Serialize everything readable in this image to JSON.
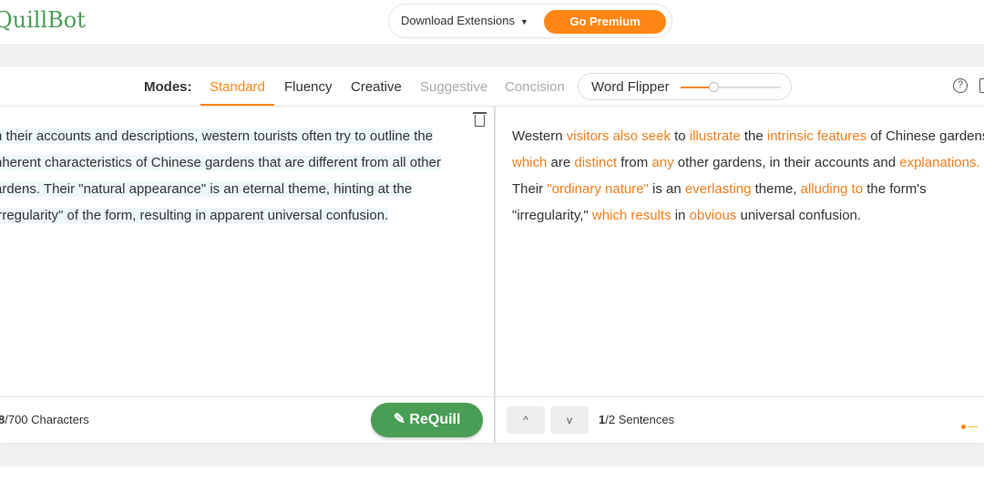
{
  "header": {
    "logo": "QuillBot",
    "download_label": "Download Extensions",
    "premium_label": "Go Premium",
    "accent": "#ff8615",
    "brand": "#4a9d54"
  },
  "modes": {
    "label": "Modes:",
    "items": [
      {
        "label": "Standard",
        "state": "active"
      },
      {
        "label": "Fluency",
        "state": "normal"
      },
      {
        "label": "Creative",
        "state": "normal"
      },
      {
        "label": "Suggestive",
        "state": "disabled"
      },
      {
        "label": "Concision",
        "state": "disabled"
      }
    ],
    "word_flipper": {
      "label": "Word Flipper",
      "level_percent": 33
    }
  },
  "input": {
    "lines": [
      "n their accounts and descriptions, western tourists often try to outline the",
      "nherent characteristics of Chinese gardens that are different from all other",
      "ardens. Their \"natural appearance\" is an eternal theme, hinting at the",
      "irregularity\" of the form, resulting in apparent universal confusion."
    ],
    "count_bold": "8",
    "count_rest": "/700 Characters",
    "requill_label": "ReQuill"
  },
  "output": {
    "lines": [
      [
        [
          "Western ",
          false
        ],
        [
          "visitors also seek",
          true
        ],
        [
          " to ",
          false
        ],
        [
          "illustrate",
          true
        ],
        [
          " the ",
          false
        ],
        [
          "intrinsic features",
          true
        ],
        [
          " of Chinese gardens",
          false
        ]
      ],
      [
        [
          "which",
          true
        ],
        [
          " are ",
          false
        ],
        [
          "distinct",
          true
        ],
        [
          " from ",
          false
        ],
        [
          "any",
          true
        ],
        [
          " other gardens, in their accounts and ",
          false
        ],
        [
          "explanations.",
          true
        ]
      ],
      [
        [
          "Their ",
          false
        ],
        [
          "\"ordinary nature\"",
          true
        ],
        [
          " is an ",
          false
        ],
        [
          "everlasting",
          true
        ],
        [
          " theme, ",
          false
        ],
        [
          "alluding to",
          true
        ],
        [
          " the form's",
          false
        ]
      ],
      [
        [
          "\"irregularity,\" ",
          false
        ],
        [
          "which results",
          true
        ],
        [
          " in ",
          false
        ],
        [
          "obvious",
          true
        ],
        [
          " universal confusion.",
          false
        ]
      ]
    ],
    "sentence_bold": "1",
    "sentence_rest": "/2 Sentences",
    "up": "^",
    "down": "v"
  }
}
